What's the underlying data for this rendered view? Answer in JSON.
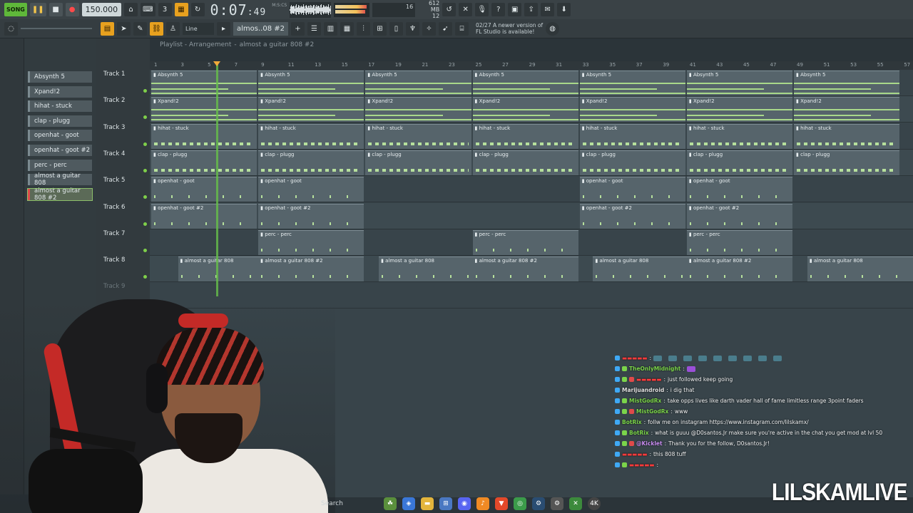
{
  "toolbar": {
    "song_mode_label": "SONG",
    "tempo": "150.000",
    "time_display": "0:07",
    "time_display_small": ":49",
    "time_unit": "M:S:CS",
    "cpu_value": "16",
    "memory": "612 MB",
    "memory_sub": "12",
    "pattern_name": "almos..08 #2",
    "snap_mode": "Line",
    "news_line1": "02/27  A newer version of",
    "news_line2": "FL Studio is available!"
  },
  "playlist": {
    "title": "Playlist - Arrangement",
    "arrangement": "almost a guitar 808 #2",
    "ruler_ticks": [
      "1",
      "3",
      "5",
      "7",
      "9",
      "11",
      "13",
      "15",
      "17",
      "19",
      "21",
      "23",
      "25",
      "27",
      "29",
      "31",
      "33",
      "35",
      "37",
      "39",
      "41",
      "43",
      "45",
      "47",
      "49",
      "51",
      "53",
      "55",
      "57"
    ],
    "tracks": [
      {
        "label": "Track 1"
      },
      {
        "label": "Track 2"
      },
      {
        "label": "Track 3"
      },
      {
        "label": "Track 4"
      },
      {
        "label": "Track 5"
      },
      {
        "label": "Track 6"
      },
      {
        "label": "Track 7"
      },
      {
        "label": "Track 8"
      },
      {
        "label": "Track 9"
      }
    ],
    "clips": [
      {
        "track": 0,
        "name": "Absynth 5",
        "starts": [
          1,
          9,
          17,
          25,
          33,
          41,
          49
        ]
      },
      {
        "track": 1,
        "name": "Xpand!2",
        "starts": [
          1,
          9,
          17,
          25,
          33,
          41,
          49
        ]
      },
      {
        "track": 2,
        "name": "hihat - stuck",
        "starts": [
          1,
          9,
          17,
          25,
          33,
          41,
          49
        ]
      },
      {
        "track": 3,
        "name": "clap - plugg",
        "starts": [
          1,
          9,
          17,
          25,
          33,
          41,
          49
        ]
      },
      {
        "track": 4,
        "name": "openhat - goot",
        "starts": [
          1,
          9,
          33,
          41
        ]
      },
      {
        "track": 5,
        "name": "openhat - goot #2",
        "starts": [
          1,
          9,
          33,
          41
        ]
      },
      {
        "track": 6,
        "name": "perc - perc",
        "starts": [
          9,
          25,
          41
        ]
      },
      {
        "track": 7,
        "name": "almost a guitar 808",
        "starts": [
          3,
          18,
          34,
          50
        ]
      },
      {
        "track": 7,
        "name": "almost a guitar 808 #2",
        "starts": [
          9,
          25,
          41
        ]
      }
    ]
  },
  "picker": {
    "items": [
      "Absynth 5",
      "Xpand!2",
      "hihat - stuck",
      "clap - plugg",
      "openhat - goot",
      "openhat - goot #2",
      "perc - perc",
      "almost a guitar 808",
      "almost a guitar 808 #2"
    ],
    "selected_index": 8
  },
  "chat": {
    "messages": [
      {
        "user": "",
        "text": "",
        "color": "#ff3b3b",
        "emotes": true
      },
      {
        "user": "TheOnlyMidnight",
        "text": "",
        "color": "#7bd44a",
        "emotes": false,
        "emoji": true
      },
      {
        "user": "",
        "text": "just followed keep going",
        "color": "#ff3b3b"
      },
      {
        "user": "Marijuandroid",
        "text": "i dig that",
        "color": "#e0e0e0"
      },
      {
        "user": "MistGodRx",
        "text": "take opps lives like darth vader hall of fame limitless range 3point faders",
        "color": "#7bd44a"
      },
      {
        "user": "MistGodRx",
        "text": "www",
        "color": "#7bd44a"
      },
      {
        "user": "BotRix",
        "text": "follw me on instagram https://www.instagram.com/lilskamx/",
        "color": "#7bd44a"
      },
      {
        "user": "BotRix",
        "text": "what is guuu @D0santos.Jr make sure you're active in the chat you get mod at lvl 50",
        "color": "#7bd44a"
      },
      {
        "user": "@Kicklet",
        "text": "Thank you for the follow, D0santos.Jr!",
        "color": "#c88cf0"
      },
      {
        "user": "",
        "text": "this 808 tuff",
        "color": "#ff3b3b"
      },
      {
        "user": "",
        "text": "",
        "color": "#ff3b3b"
      }
    ]
  },
  "taskbar": {
    "search_label": "Search",
    "items": [
      "widgets",
      "copilot",
      "files",
      "store",
      "discord",
      "fl-studio",
      "brave",
      "chrome",
      "steam",
      "settings",
      "xbox",
      "4k"
    ],
    "four_k_label": "4K"
  },
  "watermark": "LILSKAMLIVE",
  "colors": {
    "accent_green": "#67c04a",
    "clip_bg": "#56646b",
    "grid_bg": "#38444a",
    "tempo_orange": "#e8a11f"
  }
}
